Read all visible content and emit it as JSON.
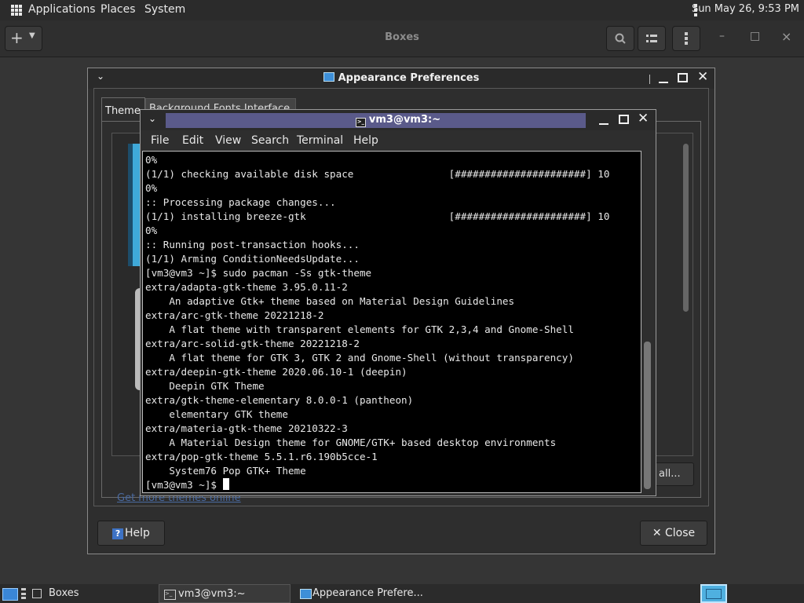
{
  "top_panel": {
    "menus": [
      "Applications",
      "Places",
      "System"
    ],
    "clock": "Sun May 26,  9:53 PM"
  },
  "boxes": {
    "title": "Boxes",
    "new_label": "+",
    "window_controls": {
      "minimize": "–",
      "maximize": "□",
      "close": "×"
    }
  },
  "appearance": {
    "title": "Appearance Preferences",
    "tab_theme": "Theme",
    "tab_other": "Background  Fonts  Interface",
    "install_label": "all...",
    "link": "Get more themes online",
    "help_label": "Help",
    "close_label": "Close"
  },
  "terminal": {
    "title": "vm3@vm3:~",
    "menu": [
      "File",
      "Edit",
      "View",
      "Search",
      "Terminal",
      "Help"
    ],
    "lines": [
      "0%",
      "(1/1) checking available disk space                [######################] 10",
      "0%",
      ":: Processing package changes...",
      "(1/1) installing breeze-gtk                        [######################] 10",
      "0%",
      ":: Running post-transaction hooks...",
      "(1/1) Arming ConditionNeedsUpdate...",
      "[vm3@vm3 ~]$ sudo pacman -Ss gtk-theme",
      "extra/adapta-gtk-theme 3.95.0.11-2",
      "    An adaptive Gtk+ theme based on Material Design Guidelines",
      "extra/arc-gtk-theme 20221218-2",
      "    A flat theme with transparent elements for GTK 2,3,4 and Gnome-Shell",
      "extra/arc-solid-gtk-theme 20221218-2",
      "    A flat theme for GTK 3, GTK 2 and Gnome-Shell (without transparency)",
      "extra/deepin-gtk-theme 2020.06.10-1 (deepin)",
      "    Deepin GTK Theme",
      "extra/gtk-theme-elementary 8.0.0-1 (pantheon)",
      "    elementary GTK theme",
      "extra/materia-gtk-theme 20210322-3",
      "    A Material Design theme for GNOME/GTK+ based desktop environments",
      "extra/pop-gtk-theme 5.5.1.r6.190b5cce-1",
      "    System76 Pop GTK+ Theme"
    ],
    "prompt": "[vm3@vm3 ~]$ "
  },
  "taskbar": {
    "boxes_label": "Boxes",
    "terminal_label": "vm3@vm3:~",
    "appearance_label": "Appearance Prefere..."
  },
  "colors": {
    "terminal_title_band": "#5a5a8a",
    "accent_blue": "#3fa9d9",
    "terminal_bg": "#000000"
  }
}
